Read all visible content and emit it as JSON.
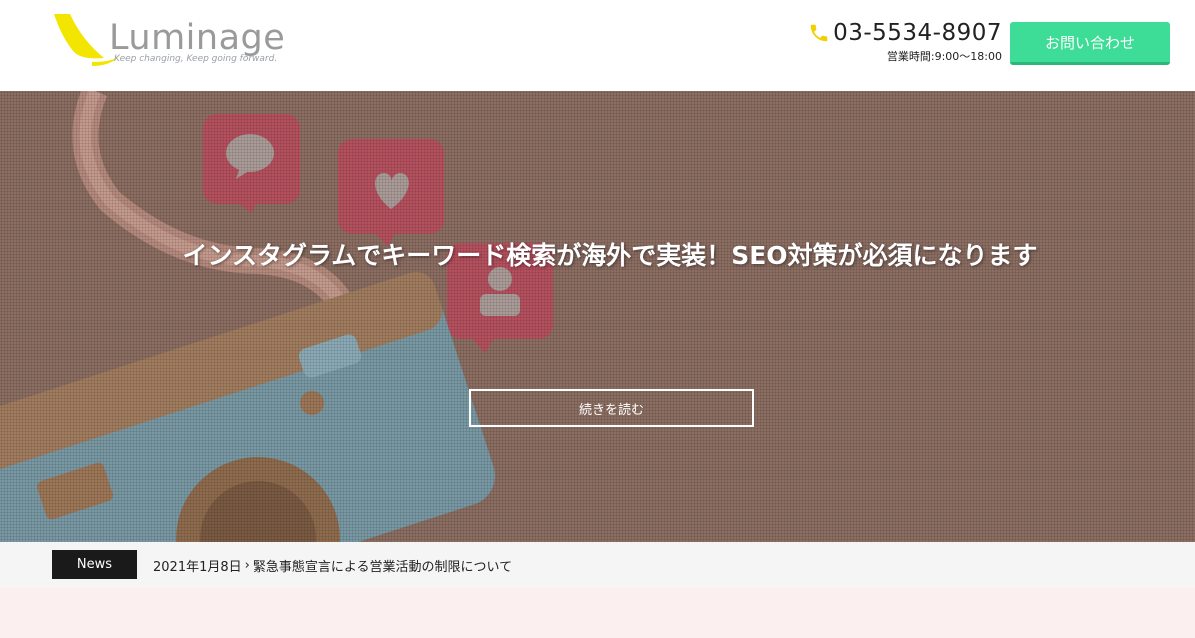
{
  "header": {
    "logo": {
      "name": "Luminage",
      "tagline": "Keep changing, Keep going forward."
    },
    "contact": {
      "phone": "03-5534-8907",
      "hours": "営業時間:9:00～18:00"
    },
    "cta_label": "お問い合わせ"
  },
  "hero": {
    "title": "インスタグラムでキーワード検索が海外で実装！SEO対策が必須になります",
    "read_more_label": "続きを読む"
  },
  "news": {
    "label": "News",
    "date": "2021年1月8日",
    "chevron": "›",
    "headline": "緊急事態宣言による営業活動の制限について"
  },
  "colors": {
    "accent": "#3ddc97",
    "logo_yellow": "#f2e600",
    "hero_overlay": "#8b6d62",
    "news_label_bg": "#1a1a1a",
    "bottom_bg": "#fbf0ef"
  },
  "icons": {
    "phone": "phone-icon",
    "logo_mark": "logo-swoosh-icon"
  }
}
